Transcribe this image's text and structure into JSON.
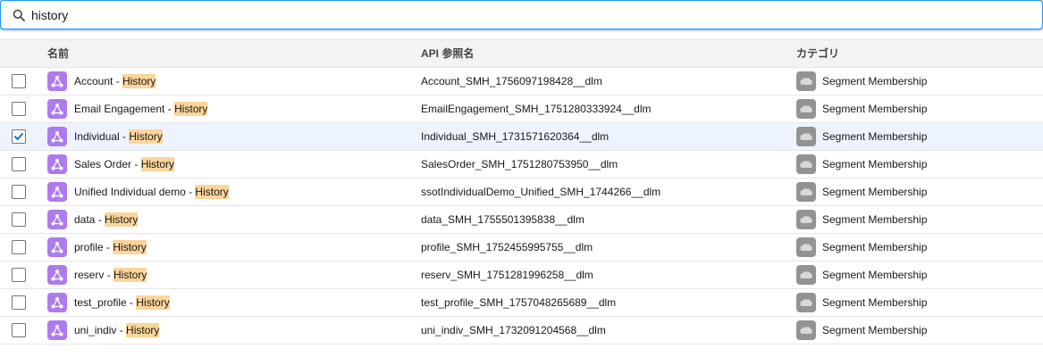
{
  "search": {
    "value": "history",
    "icon": "search-icon"
  },
  "table": {
    "columns": [
      "名前",
      "API 参照名",
      "カテゴリ"
    ],
    "highlight_color": "#fbd59a",
    "object_icon_color": "#ad7bee",
    "category_icon_color": "#939393",
    "rows": [
      {
        "name_prefix": "Account - ",
        "name_match": "History",
        "api_name": "Account_SMH_1756097198428__dlm",
        "category": "Segment Membership",
        "selected": false
      },
      {
        "name_prefix": "Email Engagement - ",
        "name_match": "History",
        "api_name": "EmailEngagement_SMH_1751280333924__dlm",
        "category": "Segment Membership",
        "selected": false
      },
      {
        "name_prefix": "Individual - ",
        "name_match": "History",
        "api_name": "Individual_SMH_1731571620364__dlm",
        "category": "Segment Membership",
        "selected": true
      },
      {
        "name_prefix": "Sales Order - ",
        "name_match": "History",
        "api_name": "SalesOrder_SMH_1751280753950__dlm",
        "category": "Segment Membership",
        "selected": false
      },
      {
        "name_prefix": "Unified Individual demo - ",
        "name_match": "History",
        "api_name": "ssotIndividualDemo_Unified_SMH_1744266__dlm",
        "category": "Segment Membership",
        "selected": false
      },
      {
        "name_prefix": "data - ",
        "name_match": "History",
        "api_name": "data_SMH_1755501395838__dlm",
        "category": "Segment Membership",
        "selected": false
      },
      {
        "name_prefix": "profile - ",
        "name_match": "History",
        "api_name": "profile_SMH_1752455995755__dlm",
        "category": "Segment Membership",
        "selected": false
      },
      {
        "name_prefix": "reserv - ",
        "name_match": "History",
        "api_name": "reserv_SMH_1751281996258__dlm",
        "category": "Segment Membership",
        "selected": false
      },
      {
        "name_prefix": "test_profile - ",
        "name_match": "History",
        "api_name": "test_profile_SMH_1757048265689__dlm",
        "category": "Segment Membership",
        "selected": false
      },
      {
        "name_prefix": "uni_indiv - ",
        "name_match": "History",
        "api_name": "uni_indiv_SMH_1732091204568__dlm",
        "category": "Segment Membership",
        "selected": false
      }
    ]
  }
}
